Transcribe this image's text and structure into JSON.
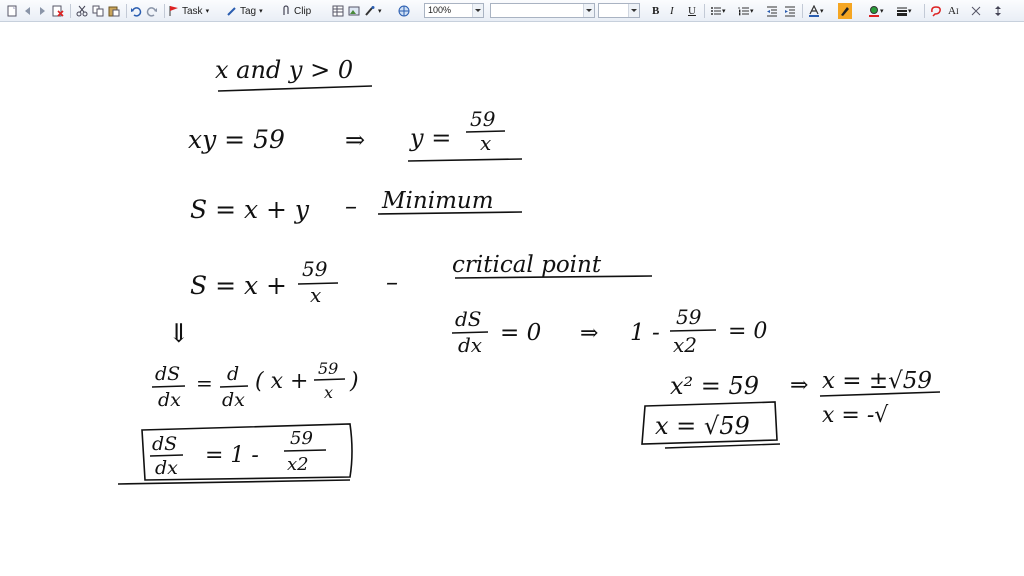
{
  "toolbar": {
    "task_label": "Task",
    "tag_label": "Tag",
    "clip_label": "Clip",
    "zoom_value": "100%",
    "font_name_value": "",
    "font_size_value": "",
    "bold_label": "B",
    "italic_label": "I",
    "underline_label": "U",
    "icons": [
      "new-page-icon",
      "back-icon",
      "forward-icon",
      "delete-page-icon",
      "cut-icon",
      "copy-icon",
      "paste-icon",
      "undo-icon",
      "redo-icon",
      "flag-icon",
      "pen-icon",
      "clip-icon",
      "table-icon",
      "image-icon",
      "brush-icon",
      "globe-icon",
      "bullets-icon",
      "numbering-icon",
      "outdent-icon",
      "indent-icon",
      "font-color-icon",
      "highlight-icon",
      "fill-color-icon",
      "line-style-icon",
      "eraser-icon",
      "text-size-icon"
    ],
    "highlight_color": "#f5a623",
    "accent_color": "#2a5db0"
  },
  "note": {
    "line1": "x and y > 0",
    "line2_left": "xy = 59",
    "line2_right_num": "59",
    "line2_right_den": "x",
    "line2_right_var": "y =",
    "line3_left": "S = x + y",
    "line3_right": "Minimum",
    "line4_left": "S = x +",
    "line4_frac_num": "59",
    "line4_frac_den": "x",
    "line4_right": "critical point",
    "deriv_lhs_num": "dS",
    "deriv_lhs_den": "dx",
    "deriv_rhs": "= 0",
    "deriv_result_left": "1 -",
    "deriv_result_num": "59",
    "deriv_result_den": "x2",
    "deriv_result_right": "= 0",
    "down_arrow": "⇓",
    "step_lhs_num": "dS",
    "step_lhs_den": "dx",
    "step_mid_num": "d",
    "step_mid_den": "dx",
    "step_paren": "( x +",
    "step_paren_num": "59",
    "step_paren_den": "x",
    "step_paren_close": ")",
    "boxed_num": "dS",
    "boxed_den": "dx",
    "boxed_rhs": "= 1 -",
    "boxed_frac_num": "59",
    "boxed_frac_den": "x2",
    "x_squared": "x² = 59",
    "x_pm": "x = ±√59",
    "boxed_x": "x = √59",
    "x_neg": "x = -√"
  }
}
